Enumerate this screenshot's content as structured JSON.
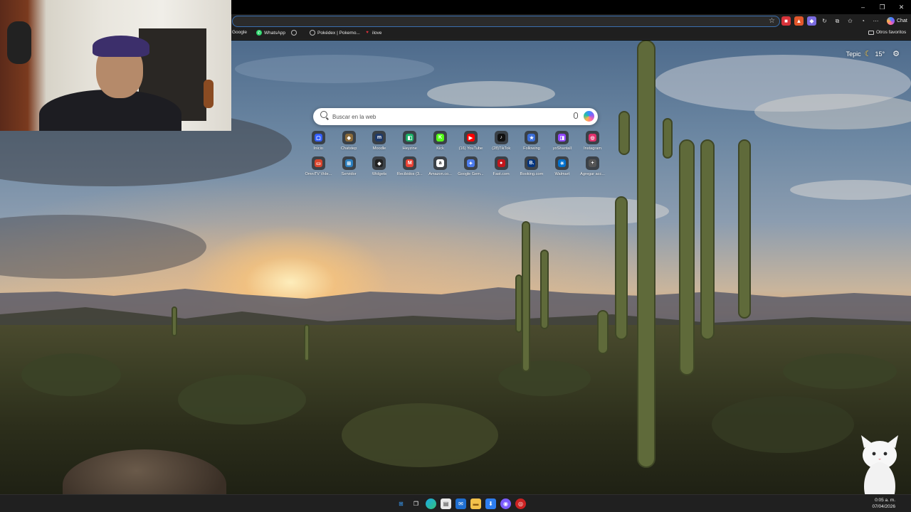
{
  "window": {
    "minimize": "–",
    "maximize": "❐",
    "close": "✕"
  },
  "toolbar": {
    "chat_label": "Chat"
  },
  "bookmarks": [
    {
      "label": "Google",
      "icon": "google-icon",
      "color": "#4285f4"
    },
    {
      "label": "WhatsApp",
      "icon": "whatsapp-icon",
      "color": "#25d366"
    },
    {
      "label": "",
      "icon": "globe-icon",
      "color": "#888888"
    },
    {
      "label": "Pokédex | Pokemo...",
      "icon": "globe-icon",
      "color": "#888888"
    },
    {
      "label": "ilove",
      "icon": "heart-icon",
      "color": "#e0313c"
    }
  ],
  "other_favorites": "Otros favoritos",
  "weather": {
    "city": "Tepic",
    "temp": "15°"
  },
  "search": {
    "placeholder": "Buscar en la web"
  },
  "tiles_row1": [
    {
      "label": "Inicio",
      "icon": "roblox-icon",
      "color": "#335fff",
      "glyph": "▢"
    },
    {
      "label": "Chatstep",
      "icon": "box-icon",
      "color": "#8a6a3a",
      "glyph": "◆"
    },
    {
      "label": "Moodle",
      "icon": "moodle-icon",
      "color": "#1e3a6b",
      "glyph": "m"
    },
    {
      "label": "Heyzine",
      "icon": "book-icon",
      "color": "#1db06a",
      "glyph": "◧"
    },
    {
      "label": "Kick",
      "icon": "kick-icon",
      "color": "#53fc18",
      "glyph": "K"
    },
    {
      "label": "(16) YouTube",
      "icon": "youtube-icon",
      "color": "#ff0000",
      "glyph": "▶"
    },
    {
      "label": "(28)TikTok",
      "icon": "tiktok-icon",
      "color": "#111111",
      "glyph": "♪"
    },
    {
      "label": "Following",
      "icon": "star-icon",
      "color": "#3b6dd6",
      "glyph": "★"
    },
    {
      "label": "yoShantall",
      "icon": "twitch-icon",
      "color": "#9146ff",
      "glyph": "◨"
    },
    {
      "label": "Instagram",
      "icon": "instagram-icon",
      "color": "#e1306c",
      "glyph": "◎"
    }
  ],
  "tiles_row2": [
    {
      "label": "OmniTV Vide...",
      "icon": "tv-icon",
      "color": "#d9442b",
      "glyph": "▭"
    },
    {
      "label": "Servidor",
      "icon": "server-icon",
      "color": "#2b7fbf",
      "glyph": "⊞"
    },
    {
      "label": "Widgets",
      "icon": "widget-icon",
      "color": "#222222",
      "glyph": "◆"
    },
    {
      "label": "Recibidos (3...",
      "icon": "gmail-icon",
      "color": "#ea4335",
      "glyph": "M"
    },
    {
      "label": "Amazon.co...",
      "icon": "amazon-icon",
      "color": "#ffffff",
      "glyph": "a"
    },
    {
      "label": "Google Gem...",
      "icon": "gemini-icon",
      "color": "#4b7bec",
      "glyph": "✦"
    },
    {
      "label": "Fast.com",
      "icon": "fast-icon",
      "color": "#c4161c",
      "glyph": "●"
    },
    {
      "label": "Booking.com",
      "icon": "booking-icon",
      "color": "#003580",
      "glyph": "B."
    },
    {
      "label": "Walmart",
      "icon": "walmart-icon",
      "color": "#0071ce",
      "glyph": "✳"
    },
    {
      "label": "Agregar acc...",
      "icon": "plus-icon",
      "color": "#555555",
      "glyph": "+"
    }
  ],
  "taskbar": {
    "time": "0:05 a. m.",
    "date": "07/04/2026"
  }
}
